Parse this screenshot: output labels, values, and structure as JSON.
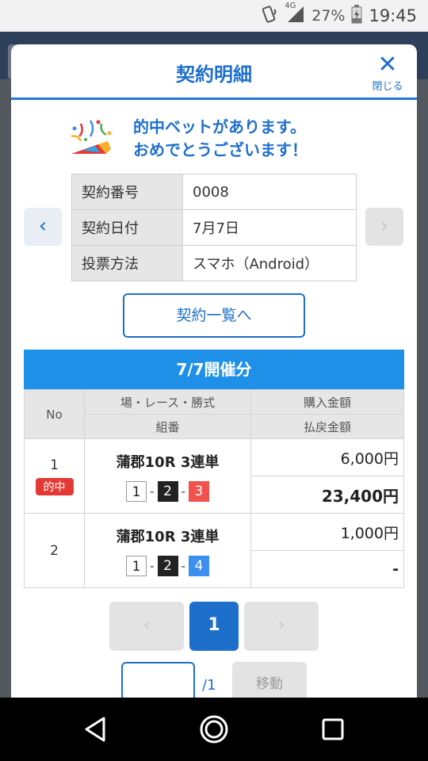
{
  "status_bar": {
    "network": "4G",
    "battery": "27%",
    "time": "19:45"
  },
  "modal": {
    "title": "契約明細",
    "close_label": "閉じる",
    "hit_message_line1": "的中ベットがあります。",
    "hit_message_line2": "おめでとうございます！",
    "info": [
      {
        "key": "契約番号",
        "value": "0008"
      },
      {
        "key": "契約日付",
        "value": "7月7日"
      },
      {
        "key": "投票方法",
        "value": "スマホ（Android）"
      }
    ],
    "list_button": "契約一覧へ",
    "date_header": "7/7開催分",
    "table_headers": {
      "no": "No",
      "race": "場・レース・勝式",
      "combo": "組番",
      "purchase": "購入金額",
      "payout": "払戻金額"
    },
    "bets": [
      {
        "no": "1",
        "badge": "的中",
        "race": "蒲郡10R 3連単",
        "n1": "1",
        "n2": "2",
        "n3": "3",
        "purchase": "6,000円",
        "payout": "23,400円"
      },
      {
        "no": "2",
        "badge": "",
        "race": "蒲郡10R 3連単",
        "n1": "1",
        "n2": "2",
        "n3": "4",
        "purchase": "1,000円",
        "payout": "-"
      }
    ],
    "pager": {
      "prev": "‹",
      "current": "1",
      "next": "›"
    },
    "goto": {
      "input_value": "",
      "total": "/1",
      "button": "移動"
    }
  },
  "colors": {
    "accent": "#1e6fcc",
    "header_bar": "#1e90e8",
    "hit_badge": "#e53935"
  }
}
